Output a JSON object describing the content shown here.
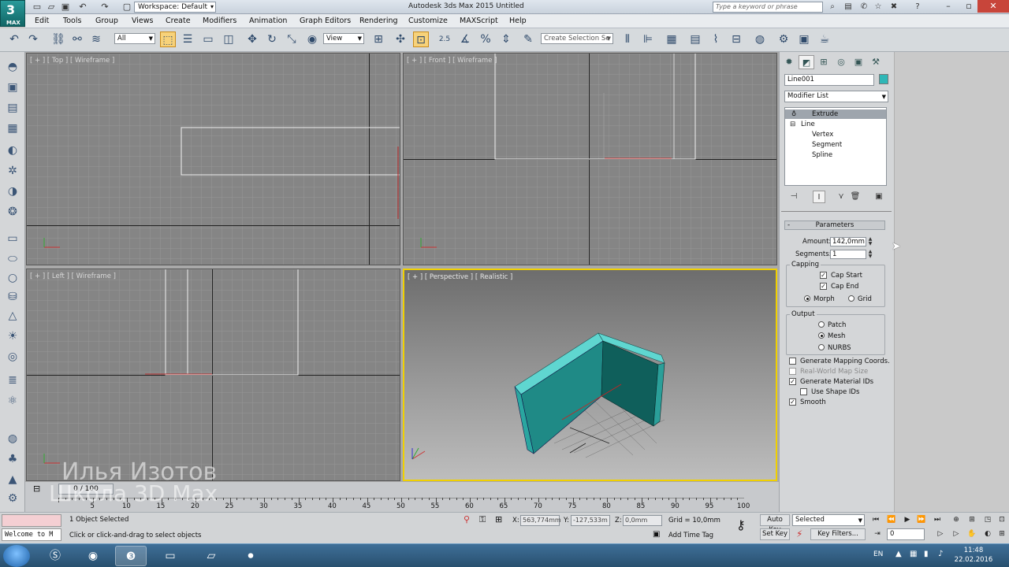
{
  "app": {
    "logo_text": "3",
    "logo_sub": "MAX",
    "window_title": "Autodesk 3ds Max 2015     Untitled",
    "workspace_label": "Workspace: Default",
    "help_placeholder": "Type a keyword or phrase"
  },
  "menu": [
    "Edit",
    "Tools",
    "Group",
    "Views",
    "Create",
    "Modifiers",
    "Animation",
    "Graph Editors",
    "Rendering",
    "Customize",
    "MAXScript",
    "Help"
  ],
  "toolbar": {
    "selection_filter": "All",
    "ref_coord": "View",
    "snap_value": "2.5",
    "create_selection_set": "Create Selection Se"
  },
  "viewports": {
    "top": "[ + ] [ Top ] [ Wireframe ]",
    "front": "[ + ] [ Front ] [ Wireframe ]",
    "left": "[ + ] [ Left ] [ Wireframe ]",
    "perspective": "[ + ] [ Perspective ] [ Realistic ]"
  },
  "watermark": {
    "line1": "Илья Изотов",
    "line2": "Школа 3D Max"
  },
  "timeline": {
    "slider": "0 / 100",
    "ticks": [
      "5",
      "10",
      "15",
      "20",
      "25",
      "30",
      "35",
      "40",
      "45",
      "50",
      "55",
      "60",
      "65",
      "70",
      "75",
      "80",
      "85",
      "90",
      "95",
      "100"
    ]
  },
  "command_panel": {
    "object_name": "Line001",
    "object_color": "#2fb7b7",
    "modifier_list": "Modifier List",
    "stack": [
      {
        "label": "Extrude",
        "selected": true
      },
      {
        "label": "Line",
        "selected": false
      },
      {
        "label": "Vertex",
        "selected": false
      },
      {
        "label": "Segment",
        "selected": false
      },
      {
        "label": "Spline",
        "selected": false
      }
    ],
    "parameters": {
      "title": "Parameters",
      "amount_label": "Amount:",
      "amount_value": "142,0mm",
      "segments_label": "Segments:",
      "segments_value": "1",
      "capping_title": "Capping",
      "cap_start": "Cap Start",
      "cap_end": "Cap End",
      "morph": "Morph",
      "grid": "Grid",
      "output_title": "Output",
      "patch": "Patch",
      "mesh": "Mesh",
      "nurbs": "NURBS",
      "gen_mapping": "Generate Mapping Coords.",
      "real_world": "Real-World Map Size",
      "gen_material": "Generate Material IDs",
      "use_shape": "Use Shape IDs",
      "smooth": "Smooth"
    }
  },
  "status": {
    "maxscript_text": "Welcome to M",
    "selection": "1 Object Selected",
    "prompt": "Click or click-and-drag to select objects",
    "x_label": "X:",
    "x_value": "563,774mm",
    "y_label": "Y:",
    "y_value": "-127,533m",
    "z_label": "Z:",
    "z_value": "0,0mm",
    "grid": "Grid = 10,0mm",
    "add_time_tag": "Add Time Tag",
    "auto_key": "Auto Key",
    "set_key": "Set Key",
    "selected_dd": "Selected",
    "key_filters": "Key Filters...",
    "frame": "0"
  },
  "taskbar": {
    "lang": "EN",
    "time": "11:48",
    "date": "22.02.2016"
  }
}
